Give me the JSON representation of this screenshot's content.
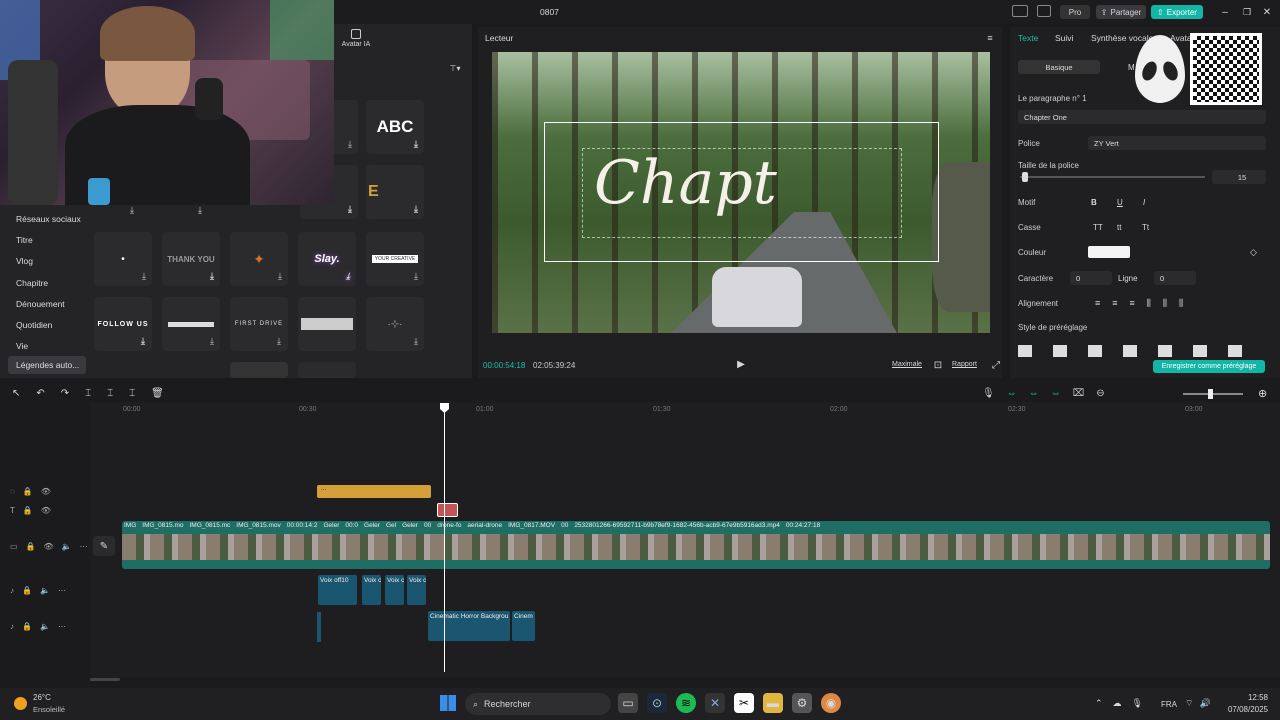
{
  "app": {
    "title": "0807",
    "pro": "Pro",
    "share": "Partager",
    "export": "Exporter"
  },
  "left": {
    "avatar_ia": "Avatar IA",
    "abc": "ABC",
    "categories": [
      "Réseaux sociaux",
      "Titre",
      "Vlog",
      "Chapitre",
      "Dénouement",
      "Quotidien",
      "Vie",
      "Légendes auto..."
    ],
    "tile_texts": [
      "THANK YOU",
      "Slay.",
      "YOUR CREATIVE",
      "FOLLOW US",
      "FIRST DRIVE"
    ]
  },
  "viewer": {
    "title": "Lecteur",
    "overlay_text": "Chapt",
    "current_time": "00:00:54:18",
    "total_time": "02:05:39:24",
    "maximale": "Maximale",
    "rapport": "Rapport"
  },
  "right": {
    "tabs": [
      "Texte",
      "Suivi",
      "Synthèse vocale",
      "Avata"
    ],
    "subtabs": [
      "Basique",
      "M"
    ],
    "paragraph": "Le paragraphe n° 1",
    "paragraph_value": "Chapter One",
    "police_label": "Police",
    "police_value": "ZY Vert",
    "size_label": "Taille de la police",
    "size_value": "15",
    "motif": "Motif",
    "casse": "Casse",
    "couleur": "Couleur",
    "caractere": "Caractère",
    "caractere_val": "0",
    "ligne": "Ligne",
    "ligne_val": "0",
    "alignement": "Alignement",
    "style": "Style de préréglage",
    "save_preset": "Enregistrer comme préréglage",
    "bold": "B",
    "underline": "U",
    "italic": "I",
    "casse_opts": [
      "TT",
      "tt",
      "Tt"
    ]
  },
  "ruler": [
    "00:00",
    "00:30",
    "01:00",
    "01:30",
    "02:00",
    "02:30",
    "03:00"
  ],
  "clips": {
    "text_clip": "...",
    "video_labels": [
      "IMG",
      "IMG_0815.mo",
      "IMG_0815.mc",
      "IMG_0815.mov",
      "00:00:14:2",
      "Geler",
      "00:0",
      "Geler",
      "Gel",
      "Geler",
      "00",
      "drone-fo",
      "aerial-drone",
      "IMG_0817.MOV",
      "00",
      "2532801266-69592711-b9b78ef9-1682-456b-acb9-67e9b5916ad3.mp4",
      "00:24:27:18"
    ],
    "audio1": [
      "Voix off10",
      "Voix c",
      "Voix c",
      "Voix c"
    ],
    "audio2": [
      "Cinematic Horror Backgrou",
      "Cinem"
    ]
  },
  "taskbar": {
    "temp": "26°C",
    "weather": "Ensoleillé",
    "search": "Rechercher",
    "lang": "FRA",
    "time": "12:58",
    "date": "07/08/2025"
  },
  "colors": {
    "accent": "#1fbfa8",
    "export": "#13b5a6",
    "text_clip": "#d4a03a",
    "video_track": "#1e6e66",
    "audio": "#1b5670",
    "marker": "#c15454"
  }
}
